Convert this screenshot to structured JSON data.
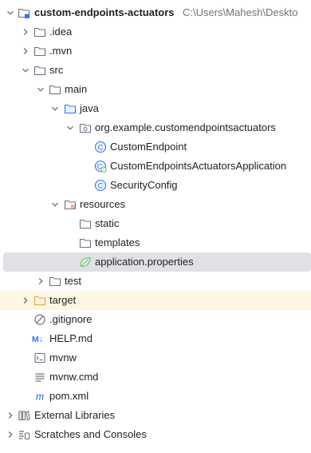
{
  "project": {
    "name": "custom-endpoints-actuators",
    "path": "C:\\Users\\Mahesh\\Deskto"
  },
  "nodes": {
    "idea": ".idea",
    "mvn": ".mvn",
    "src": "src",
    "main": "main",
    "java": "java",
    "package": "org.example.customendpointsactuators",
    "custom_endpoint": "CustomEndpoint",
    "application_class": "CustomEndpointsActuatorsApplication",
    "security_config": "SecurityConfig",
    "resources": "resources",
    "static": "static",
    "templates": "templates",
    "application_properties": "application.properties",
    "test": "test",
    "target": "target",
    "gitignore": ".gitignore",
    "help_md": "HELP.md",
    "mvnw": "mvnw",
    "mvnw_cmd": "mvnw.cmd",
    "pom_xml": "pom.xml",
    "external_libraries": "External Libraries",
    "scratches": "Scratches and Consoles"
  },
  "icon_badges": {
    "class": "C",
    "markdown": "M↓",
    "maven": "m"
  },
  "colors": {
    "folder_stroke": "#6c707e",
    "source_folder": "#3574f0",
    "resources_folder": "#e5884f",
    "excluded_folder": "#e5a24c",
    "class_icon": "#3574f0",
    "spring_leaf": "#5fb865",
    "maven_blue": "#3574f0",
    "selection": "#dfe1e5"
  }
}
